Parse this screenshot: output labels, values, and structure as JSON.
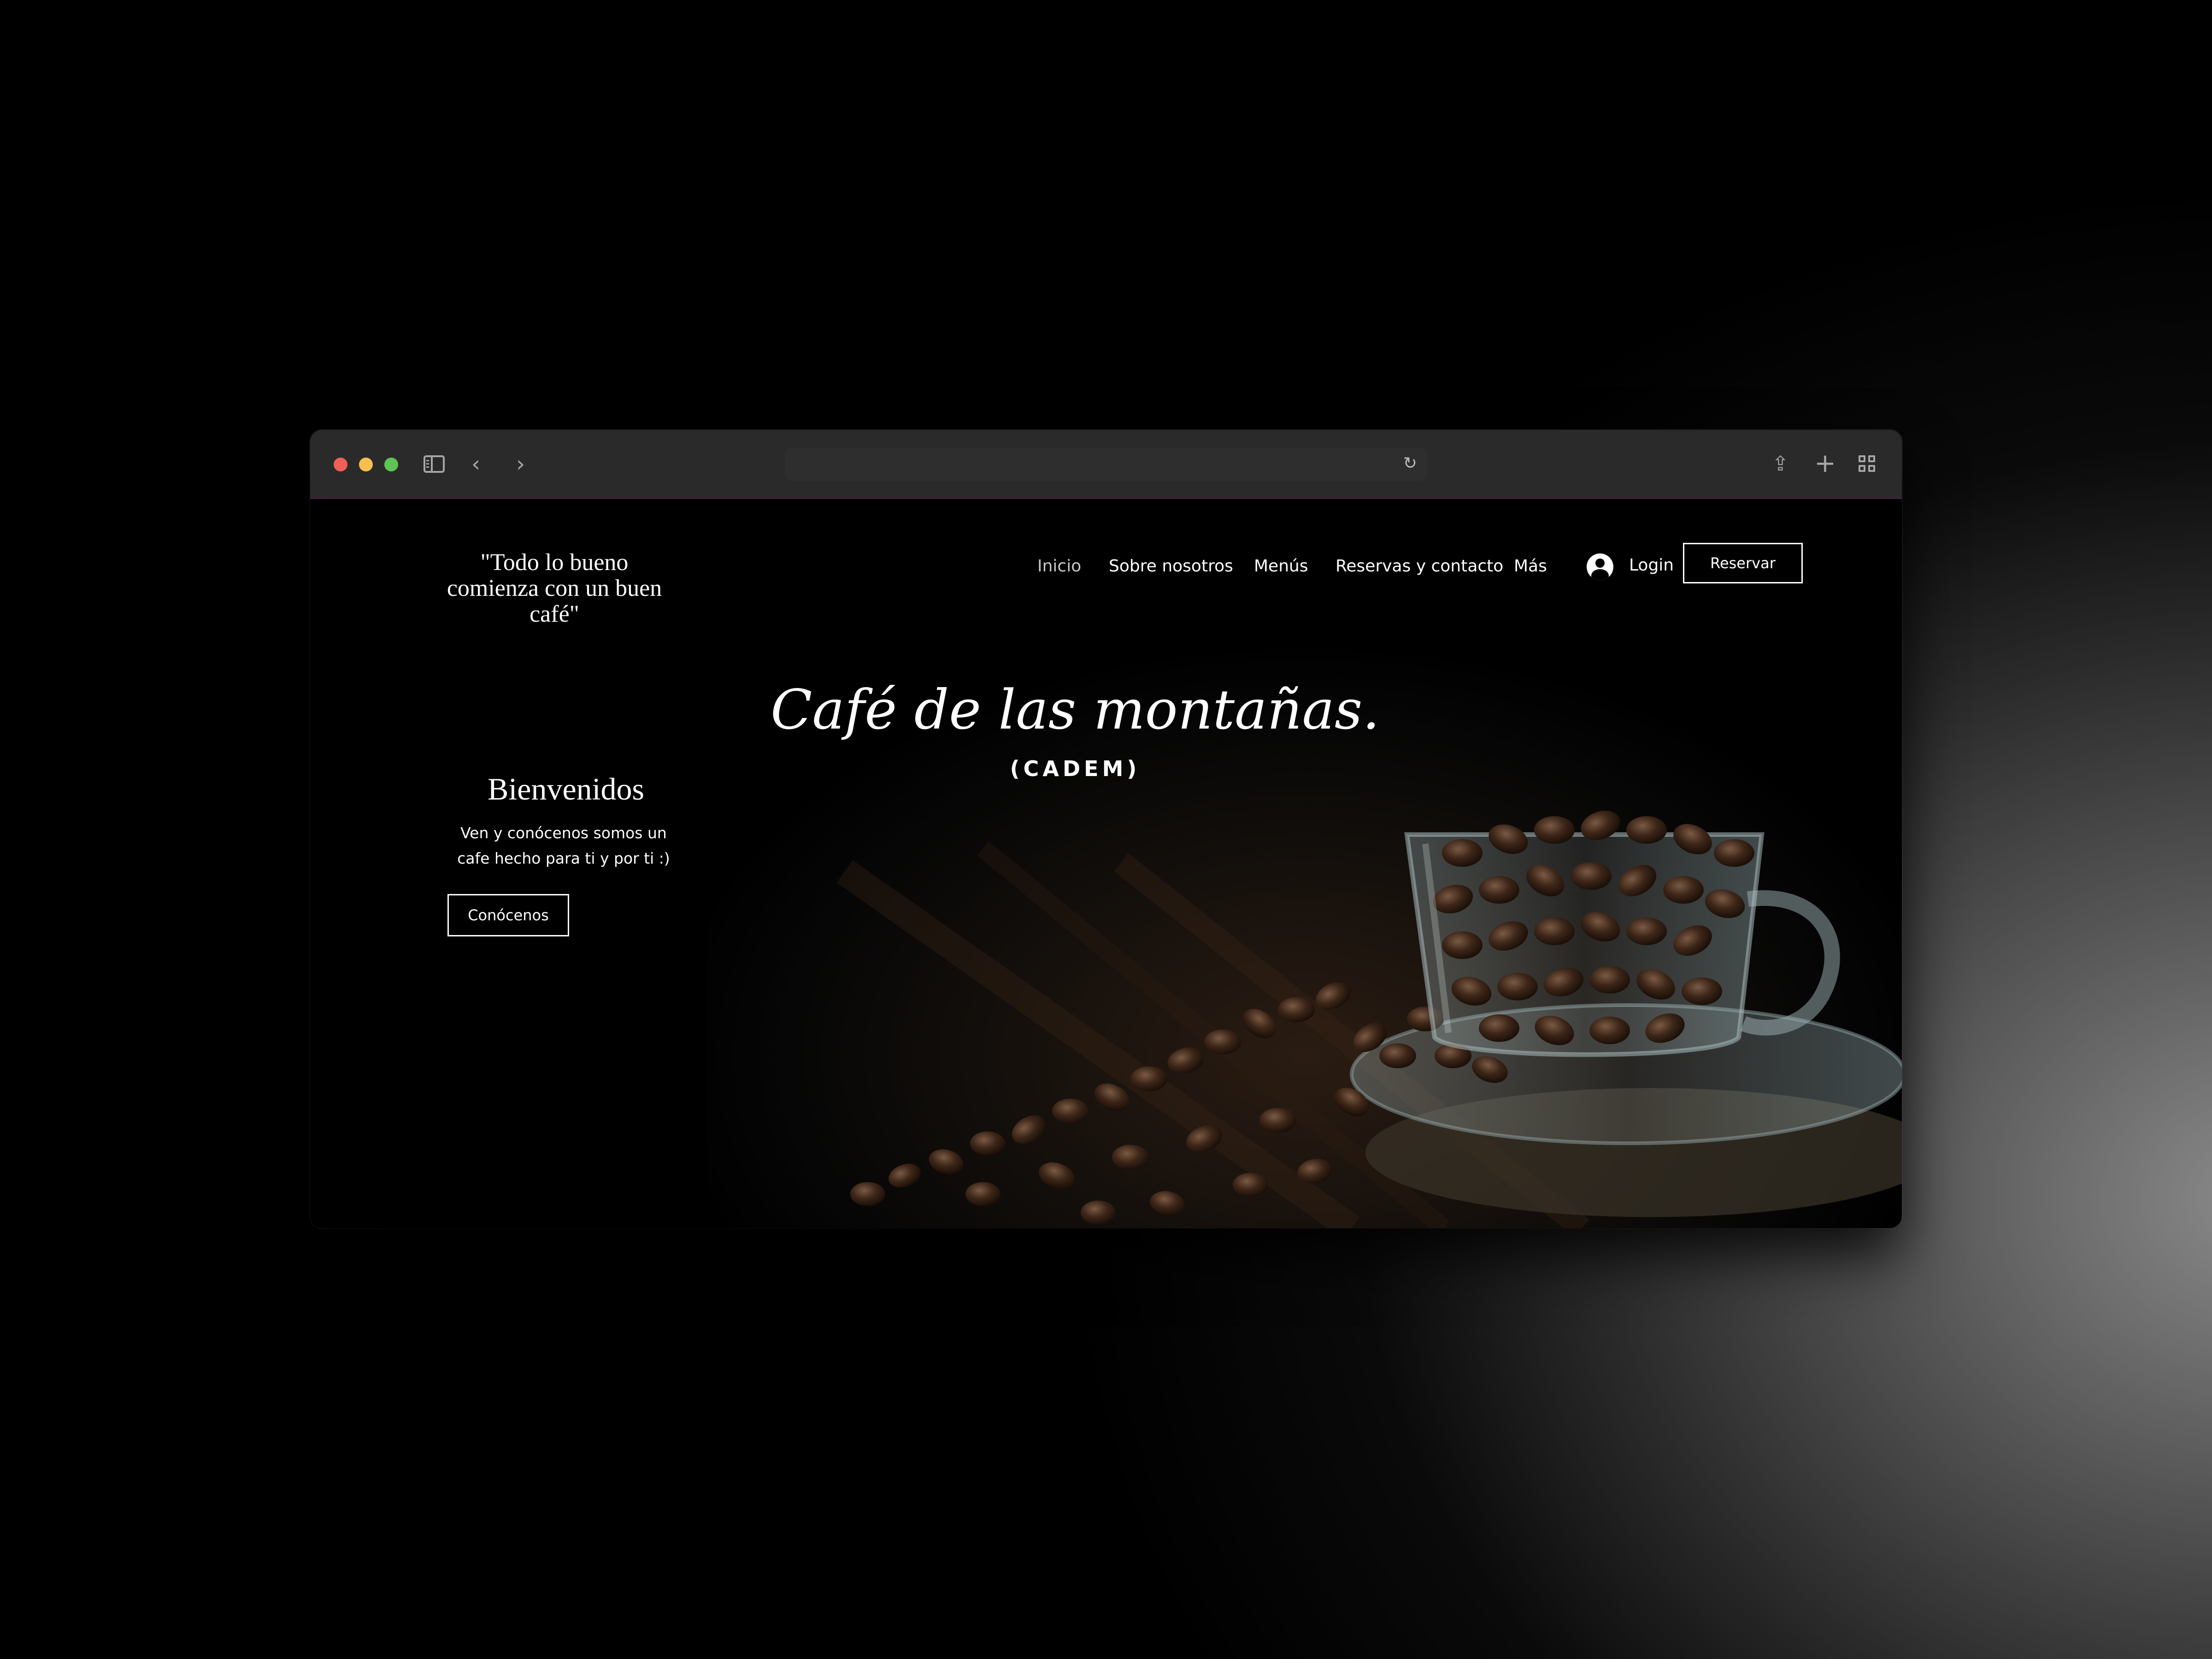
{
  "browser": {
    "icons": [
      "sidebar-icon",
      "back-icon",
      "forward-icon",
      "reload-icon",
      "share-icon",
      "new-tab-icon",
      "tab-overview-icon"
    ]
  },
  "site": {
    "tagline": "\"Todo lo bueno comienza con un buen café\"",
    "nav": {
      "inicio": "Inicio",
      "sobre": "Sobre nosotros",
      "menus": "Menús",
      "reservas": "Reservas y contacto",
      "mas": "Más"
    },
    "login": "Login",
    "reservar": "Reservar",
    "welcome": {
      "title": "Bienvenidos",
      "text_line1": "Ven y conócenos somos un",
      "text_line2": "cafe hecho para ti y por ti :)",
      "button": "Conócenos"
    },
    "hero": {
      "title": "Café de las montañas.",
      "subtitle": "(CADEM)"
    }
  },
  "colors": {
    "background": "#000000",
    "chrome": "#2b2a2a",
    "text": "#ffffff"
  }
}
